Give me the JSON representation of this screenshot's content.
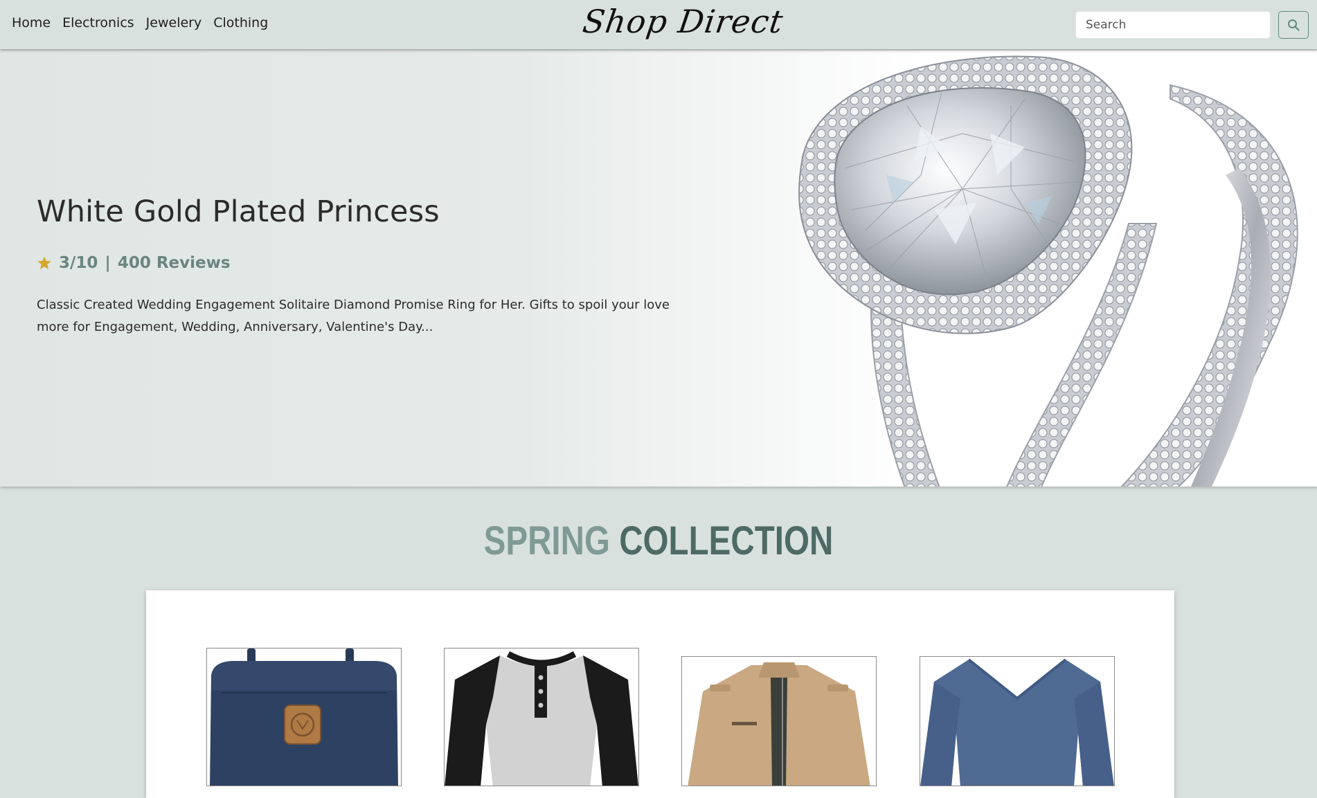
{
  "nav": {
    "links": [
      "Home",
      "Electronics",
      "Jewelery",
      "Clothing"
    ],
    "brand": "Shop Direct",
    "search_placeholder": "Search",
    "search_value": ""
  },
  "hero": {
    "title": "White Gold Plated Princess",
    "rating": "3/10",
    "separator": "|",
    "reviews": "400 Reviews",
    "description": "Classic Created Wedding Engagement Solitaire Diamond Promise Ring for Her. Gifts to spoil your love more for Engagement, Wedding, Anniversary, Valentine's Day..."
  },
  "section": {
    "title_part1": "SPRING",
    "title_part2": "COLLECTION"
  },
  "products": [
    {
      "name": "backpack"
    },
    {
      "name": "henley-shirt"
    },
    {
      "name": "cotton-jacket"
    },
    {
      "name": "slim-fit-shirt"
    }
  ],
  "colors": {
    "background": "#d9e1de",
    "accent": "#5d8a7c",
    "star": "#d4a72c",
    "title_light": "#7f9a94",
    "title_dark": "#4e6a65"
  }
}
